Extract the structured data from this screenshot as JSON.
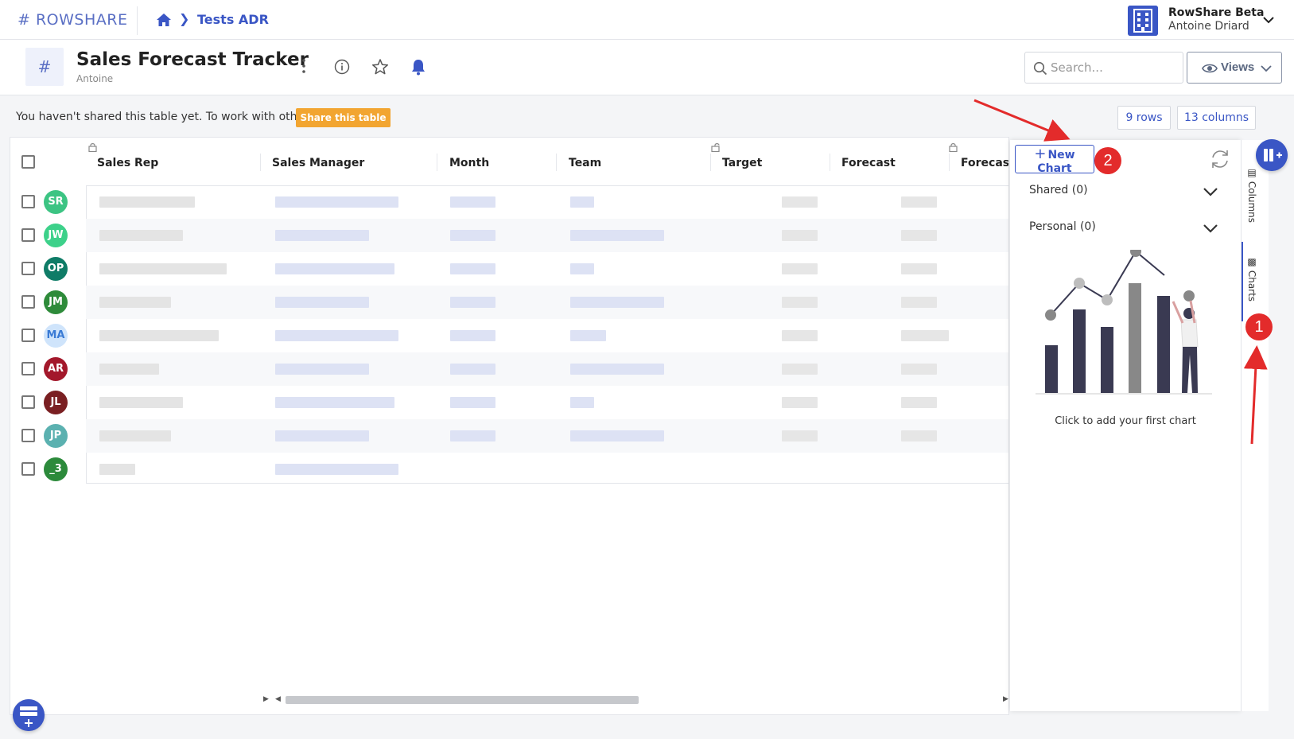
{
  "topbar": {
    "logo": "# ROWSHARE",
    "breadcrumb_current": "Tests ADR",
    "org_name": "RowShare Beta",
    "user_name": "Antoine Driard"
  },
  "header": {
    "table_icon": "#",
    "title": "Sales Forecast Tracker",
    "owner": "Antoine",
    "search_placeholder": "Search...",
    "views_label": "Views"
  },
  "share_banner": {
    "text": "You haven't shared this table yet. To work with others:",
    "button_label": "Share this table",
    "rows_label": "9 rows",
    "columns_label": "13 columns"
  },
  "grid": {
    "columns": [
      "Sales Rep",
      "Sales Manager",
      "Month",
      "Team",
      "Target",
      "Forecast",
      "Forecast"
    ],
    "rows": [
      {
        "initials": "SR",
        "color": "#3cc483"
      },
      {
        "initials": "JW",
        "color": "#3dd18a"
      },
      {
        "initials": "OP",
        "color": "#0f7c67"
      },
      {
        "initials": "JM",
        "color": "#2e8b3a"
      },
      {
        "initials": "MA",
        "color": "#cfe4fb"
      },
      {
        "initials": "AR",
        "color": "#a3182b"
      },
      {
        "initials": "JL",
        "color": "#7a1f22"
      },
      {
        "initials": "JP",
        "color": "#5bb1b0"
      },
      {
        "initials": "_3",
        "color": "#2c8a3b"
      }
    ]
  },
  "charts_panel": {
    "new_chart_label": "New Chart",
    "sections": [
      {
        "label": "Shared (0)"
      },
      {
        "label": "Personal (0)"
      }
    ],
    "empty_text": "Click to add your first chart"
  },
  "side_tabs": {
    "columns_label": "Columns",
    "charts_label": "Charts"
  },
  "annotations": {
    "badge_1": "1",
    "badge_2": "2"
  },
  "colors": {
    "accent": "#3a56c5",
    "share_button": "#f2a531",
    "annotation": "#e32b2b"
  }
}
